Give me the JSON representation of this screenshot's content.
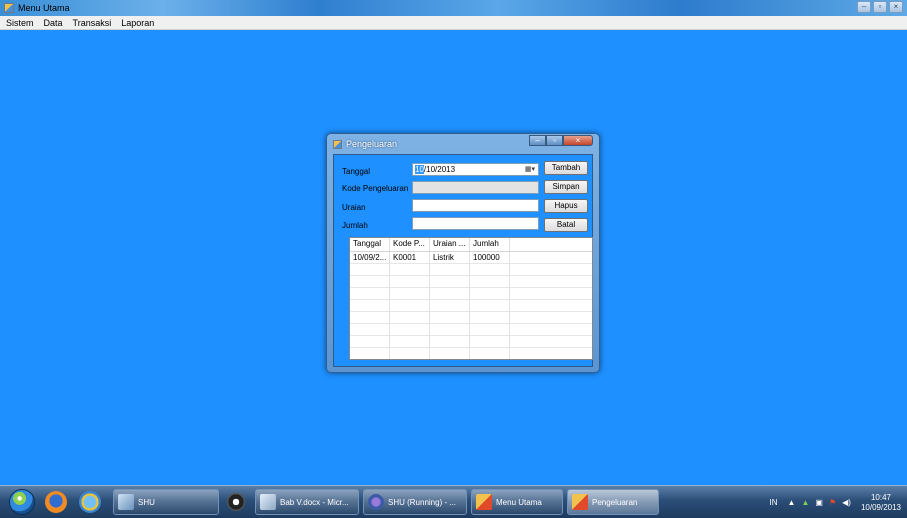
{
  "main_window": {
    "title": "Menu Utama",
    "menu": [
      "Sistem",
      "Data",
      "Transaksi",
      "Laporan"
    ]
  },
  "dialog": {
    "title": "Pengeluaran",
    "labels": {
      "tanggal": "Tanggal",
      "kode": "Kode Pengeluaran",
      "uraian": "Uraian",
      "jumlah": "Jumlah"
    },
    "date_value": {
      "day": "10",
      "rest": "/10/2013"
    },
    "kode_value": "",
    "uraian_value": "",
    "jumlah_value": "",
    "buttons": {
      "tambah": "Tambah",
      "simpan": "Simpan",
      "hapus": "Hapus",
      "batal": "Batal"
    },
    "grid": {
      "columns": [
        "Tanggal",
        "Kode P...",
        "Uraian ...",
        "Jumlah"
      ],
      "rows": [
        [
          "10/09/2...",
          "K0001",
          "Listrik",
          "100000"
        ]
      ]
    }
  },
  "taskbar": {
    "items": [
      {
        "label": "SHU",
        "icon": "shu-icon"
      },
      {
        "label": "Bab V.docx - Micr...",
        "icon": "word-icon"
      },
      {
        "label": "SHU (Running) - ...",
        "icon": "visual-studio-icon"
      },
      {
        "label": "Menu Utama",
        "icon": "app-icon"
      },
      {
        "label": "Pengeluaran",
        "icon": "app-icon"
      }
    ],
    "tray": {
      "language": "IN",
      "time": "10:47",
      "date": "10/09/2013"
    }
  }
}
